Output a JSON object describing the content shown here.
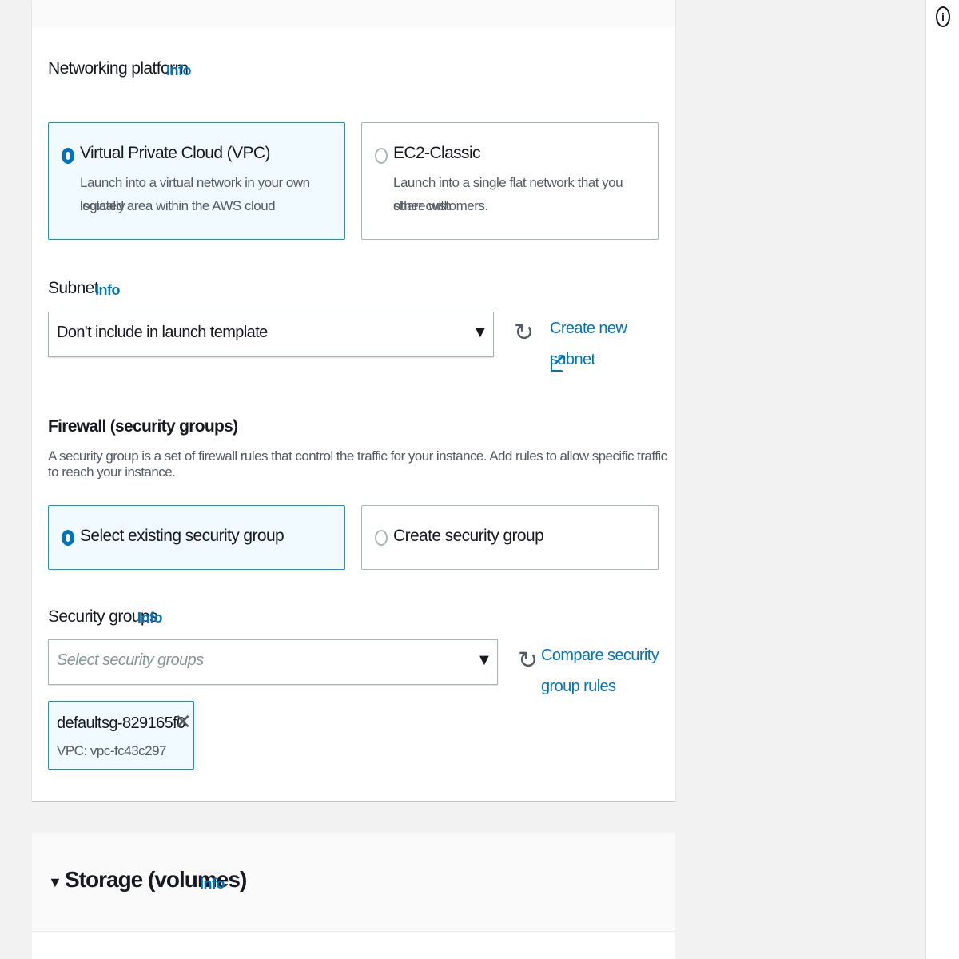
{
  "networking": {
    "label": "Networking platform",
    "info": "Info",
    "options": [
      {
        "title": "Virtual Private Cloud (VPC)",
        "desc1": "Launch into a virtual network in your own logically",
        "desc2": "isolated area within the AWS cloud",
        "selected": true
      },
      {
        "title": "EC2-Classic",
        "desc1": "Launch into a single flat network that you share with",
        "desc2": "other customers.",
        "selected": false
      }
    ]
  },
  "subnet": {
    "label": "Subnet",
    "info": "Info",
    "value": "Don't include in launch template",
    "create_link": "Create new subnet"
  },
  "firewall": {
    "heading": "Firewall (security groups)",
    "description": "A security group is a set of firewall rules that control the traffic for your instance. Add rules to allow specific traffic to reach your instance.",
    "options": [
      {
        "title": "Select existing security group",
        "selected": true
      },
      {
        "title": "Create security group",
        "selected": false
      }
    ]
  },
  "security_groups": {
    "label": "Security groups",
    "info": "Info",
    "placeholder": "Select security groups",
    "compare_link_line1": "Compare security",
    "compare_link_line2": "group rules",
    "token": {
      "name": "default",
      "id": "sg-829165f0",
      "vpc": "VPC: vpc-fc43c297"
    }
  },
  "storage": {
    "title": "Storage (volumes)",
    "info": "Info"
  },
  "icons": {
    "refresh": "refresh-icon",
    "external": "external-link-icon",
    "caret": "caret-down-icon",
    "close": "close-icon",
    "info": "info-circle-icon"
  },
  "colors": {
    "link": "#0073bb",
    "selected_border": "#00a1c9",
    "selected_bg": "#f1faff",
    "border": "#aab7b8"
  }
}
